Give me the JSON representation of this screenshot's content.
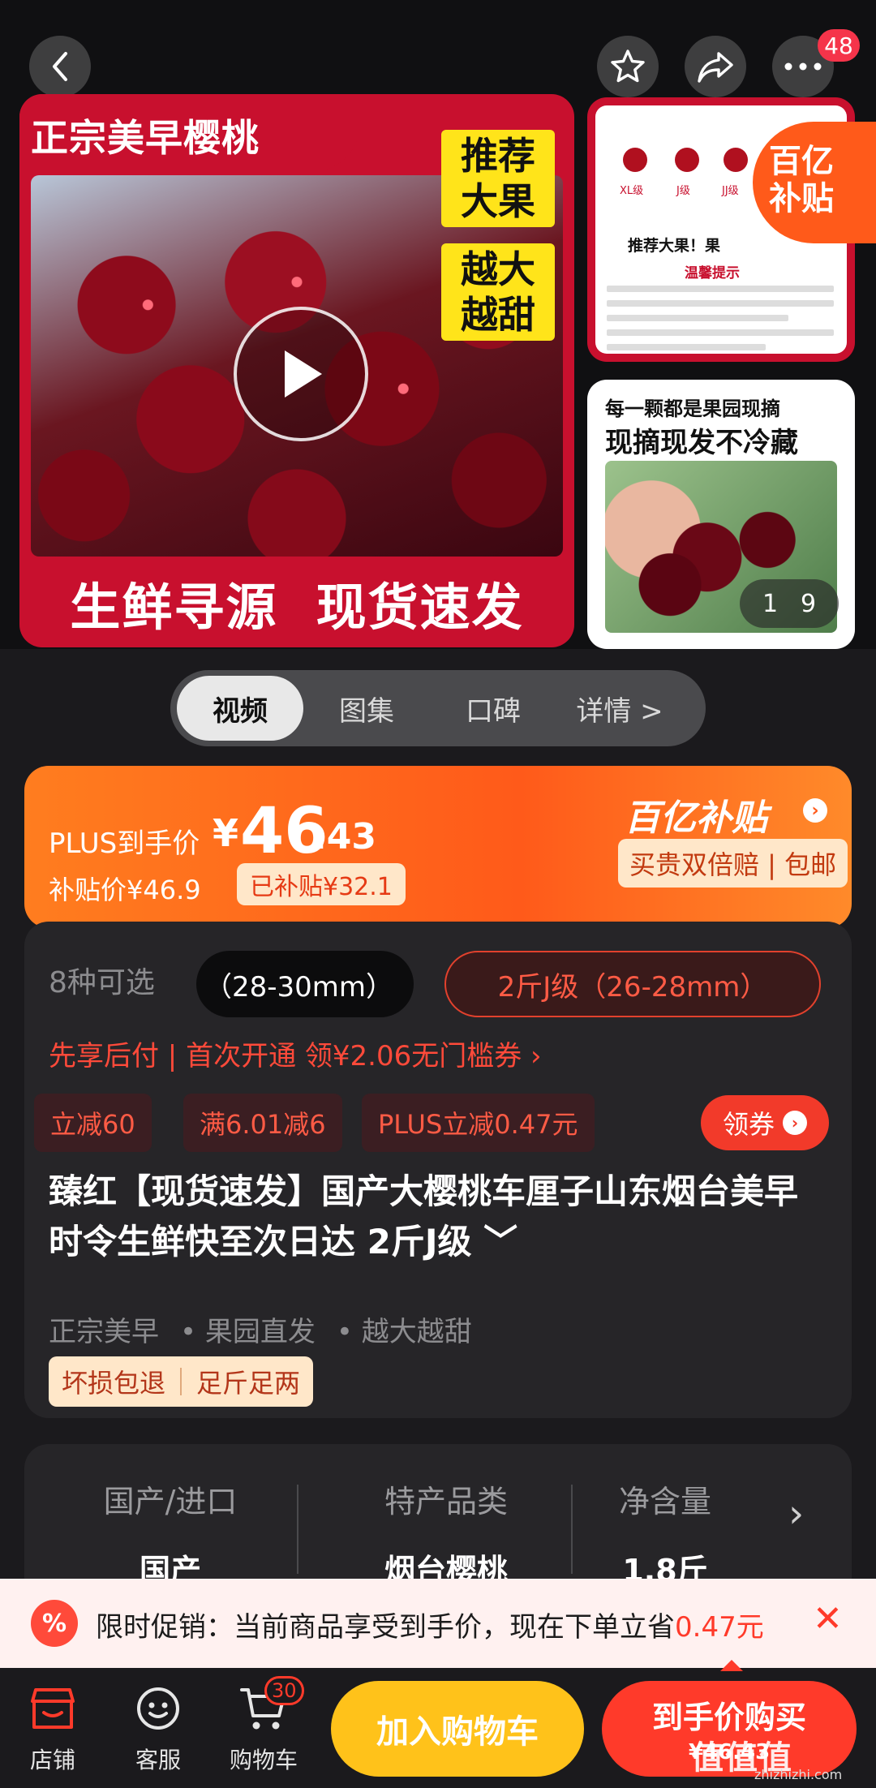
{
  "header": {
    "more_badge": "48"
  },
  "gallery": {
    "main_title": "正宗美早樱桃",
    "tag1": "推荐\n大果",
    "tag2": "越大\n越甜",
    "main_bottom": "生鲜寻源  现货速发",
    "thumb1": {
      "labels": [
        "XL级",
        "J级",
        "JJ级"
      ],
      "recommend": "推荐大果！果",
      "tip": "温馨提示"
    },
    "subsidy_stamp": "百亿\n补贴",
    "thumb2": {
      "line1": "每一颗都是果园现摘",
      "line2": "现摘现发不冷藏"
    },
    "counter_current": "1",
    "counter_total": "9"
  },
  "tabs": [
    {
      "label": "视频",
      "active": true
    },
    {
      "label": "图集",
      "active": false
    },
    {
      "label": "口碑",
      "active": false
    },
    {
      "label": "详情 >",
      "active": false
    }
  ],
  "price": {
    "plus_label": "PLUS到手价",
    "yuan": "¥",
    "integer": "46",
    "decimal": ".43",
    "subsidy_price": "补贴价¥46.9",
    "subsidy_tag": "已补贴¥32.1",
    "yi_logo": "百亿补贴",
    "yi_arrow": "›",
    "yi_tags": "买贵双倍赔 | 包邮"
  },
  "product": {
    "option_count": "8种可选",
    "option1": "（28-30mm）",
    "option2": "2斤J级（26-28mm）",
    "pay_later": "先享后付 | 首次开通  领¥2.06无门槛券 ›",
    "promos": [
      "立减60",
      "满6.01减6",
      "PLUS立减0.47元"
    ],
    "coupon_btn": "领券",
    "coupon_arrow": "›",
    "title": "臻红【现货速发】国产大樱桃车厘子山东烟台美早时令生鲜快至次日达 2斤J级 ﹀",
    "features": [
      "正宗美早",
      "•  果园直发",
      "•  越大越甜"
    ],
    "guarantees": [
      "坏损包退",
      "足斤足两"
    ]
  },
  "attributes": [
    {
      "key": "国产/进口",
      "value": "国产"
    },
    {
      "key": "特产品类",
      "value": "烟台樱桃"
    },
    {
      "key": "净含量",
      "value": "1.8斤"
    }
  ],
  "attr_arrow": "›",
  "promo_bar": {
    "icon": "%",
    "text": "限时促销：当前商品享受到手价，现在下单立省",
    "highlight": "0.47元",
    "close": "✕"
  },
  "bottom_nav": {
    "items": [
      {
        "label": "店铺",
        "icon": "store-icon"
      },
      {
        "label": "客服",
        "icon": "customer-service-icon"
      },
      {
        "label": "购物车",
        "icon": "cart-icon"
      }
    ],
    "cart_badge": "30",
    "add_to_cart": "加入购物车",
    "buy_now": "到手价购买",
    "buy_now_price": "¥46.43"
  },
  "watermark": {
    "main": "值值值",
    "sub": "zhizhizhi.com"
  },
  "colors": {
    "accent_red": "#ff3a2a",
    "accent_orange": "#ff5a1a",
    "add_cart_yellow": "#ffc21a"
  }
}
